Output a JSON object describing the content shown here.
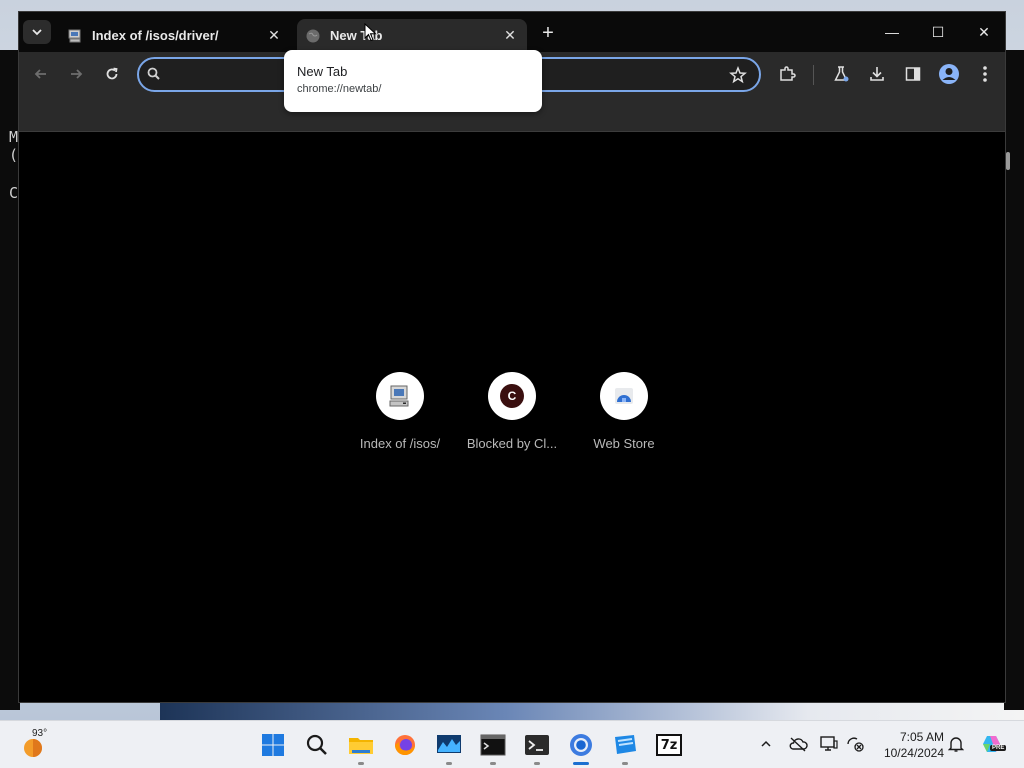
{
  "browser": {
    "tabs": [
      {
        "title": "Index of /isos/driver/",
        "active": false,
        "icon": "computer-favicon-icon"
      },
      {
        "title": "New Tab",
        "active": true,
        "icon": "globe-icon"
      }
    ],
    "new_tab_symbol": "+",
    "window_controls": {
      "minimize": "—",
      "maximize": "☐",
      "close": "✕"
    },
    "omnibox": {
      "value": "",
      "placeholder": ""
    },
    "accent_color": "#7aa6e8"
  },
  "tooltip": {
    "title": "New Tab",
    "url": "chrome://newtab/"
  },
  "shortcuts": [
    {
      "label": "Index of /isos/",
      "icon": "computer-favicon-icon"
    },
    {
      "label": "Blocked by Cl...",
      "icon": "letter-c-avatar-icon",
      "letter": "C"
    },
    {
      "label": "Web Store",
      "icon": "web-store-icon"
    }
  ],
  "background_terminal": {
    "lines": [
      "M",
      "(",
      "",
      "C"
    ]
  },
  "taskbar": {
    "weather_temp": "93°",
    "apps": [
      {
        "name": "windows-start",
        "icon": "windows-logo-icon"
      },
      {
        "name": "search",
        "icon": "search-icon"
      },
      {
        "name": "file-explorer",
        "icon": "folder-icon"
      },
      {
        "name": "firefox",
        "icon": "firefox-icon"
      },
      {
        "name": "resource-monitor",
        "icon": "chart-app-icon"
      },
      {
        "name": "command-prompt",
        "icon": "cmd-icon"
      },
      {
        "name": "terminal",
        "icon": "terminal-icon"
      },
      {
        "name": "chrome",
        "icon": "chrome-icon",
        "active": true
      },
      {
        "name": "app-blue",
        "icon": "blue-app-icon"
      },
      {
        "name": "7zip",
        "icon": "7zip-icon",
        "text": "7z"
      }
    ],
    "clock_time": "7:05 AM",
    "clock_date": "10/24/2024",
    "copilot_badge": "PRE"
  }
}
